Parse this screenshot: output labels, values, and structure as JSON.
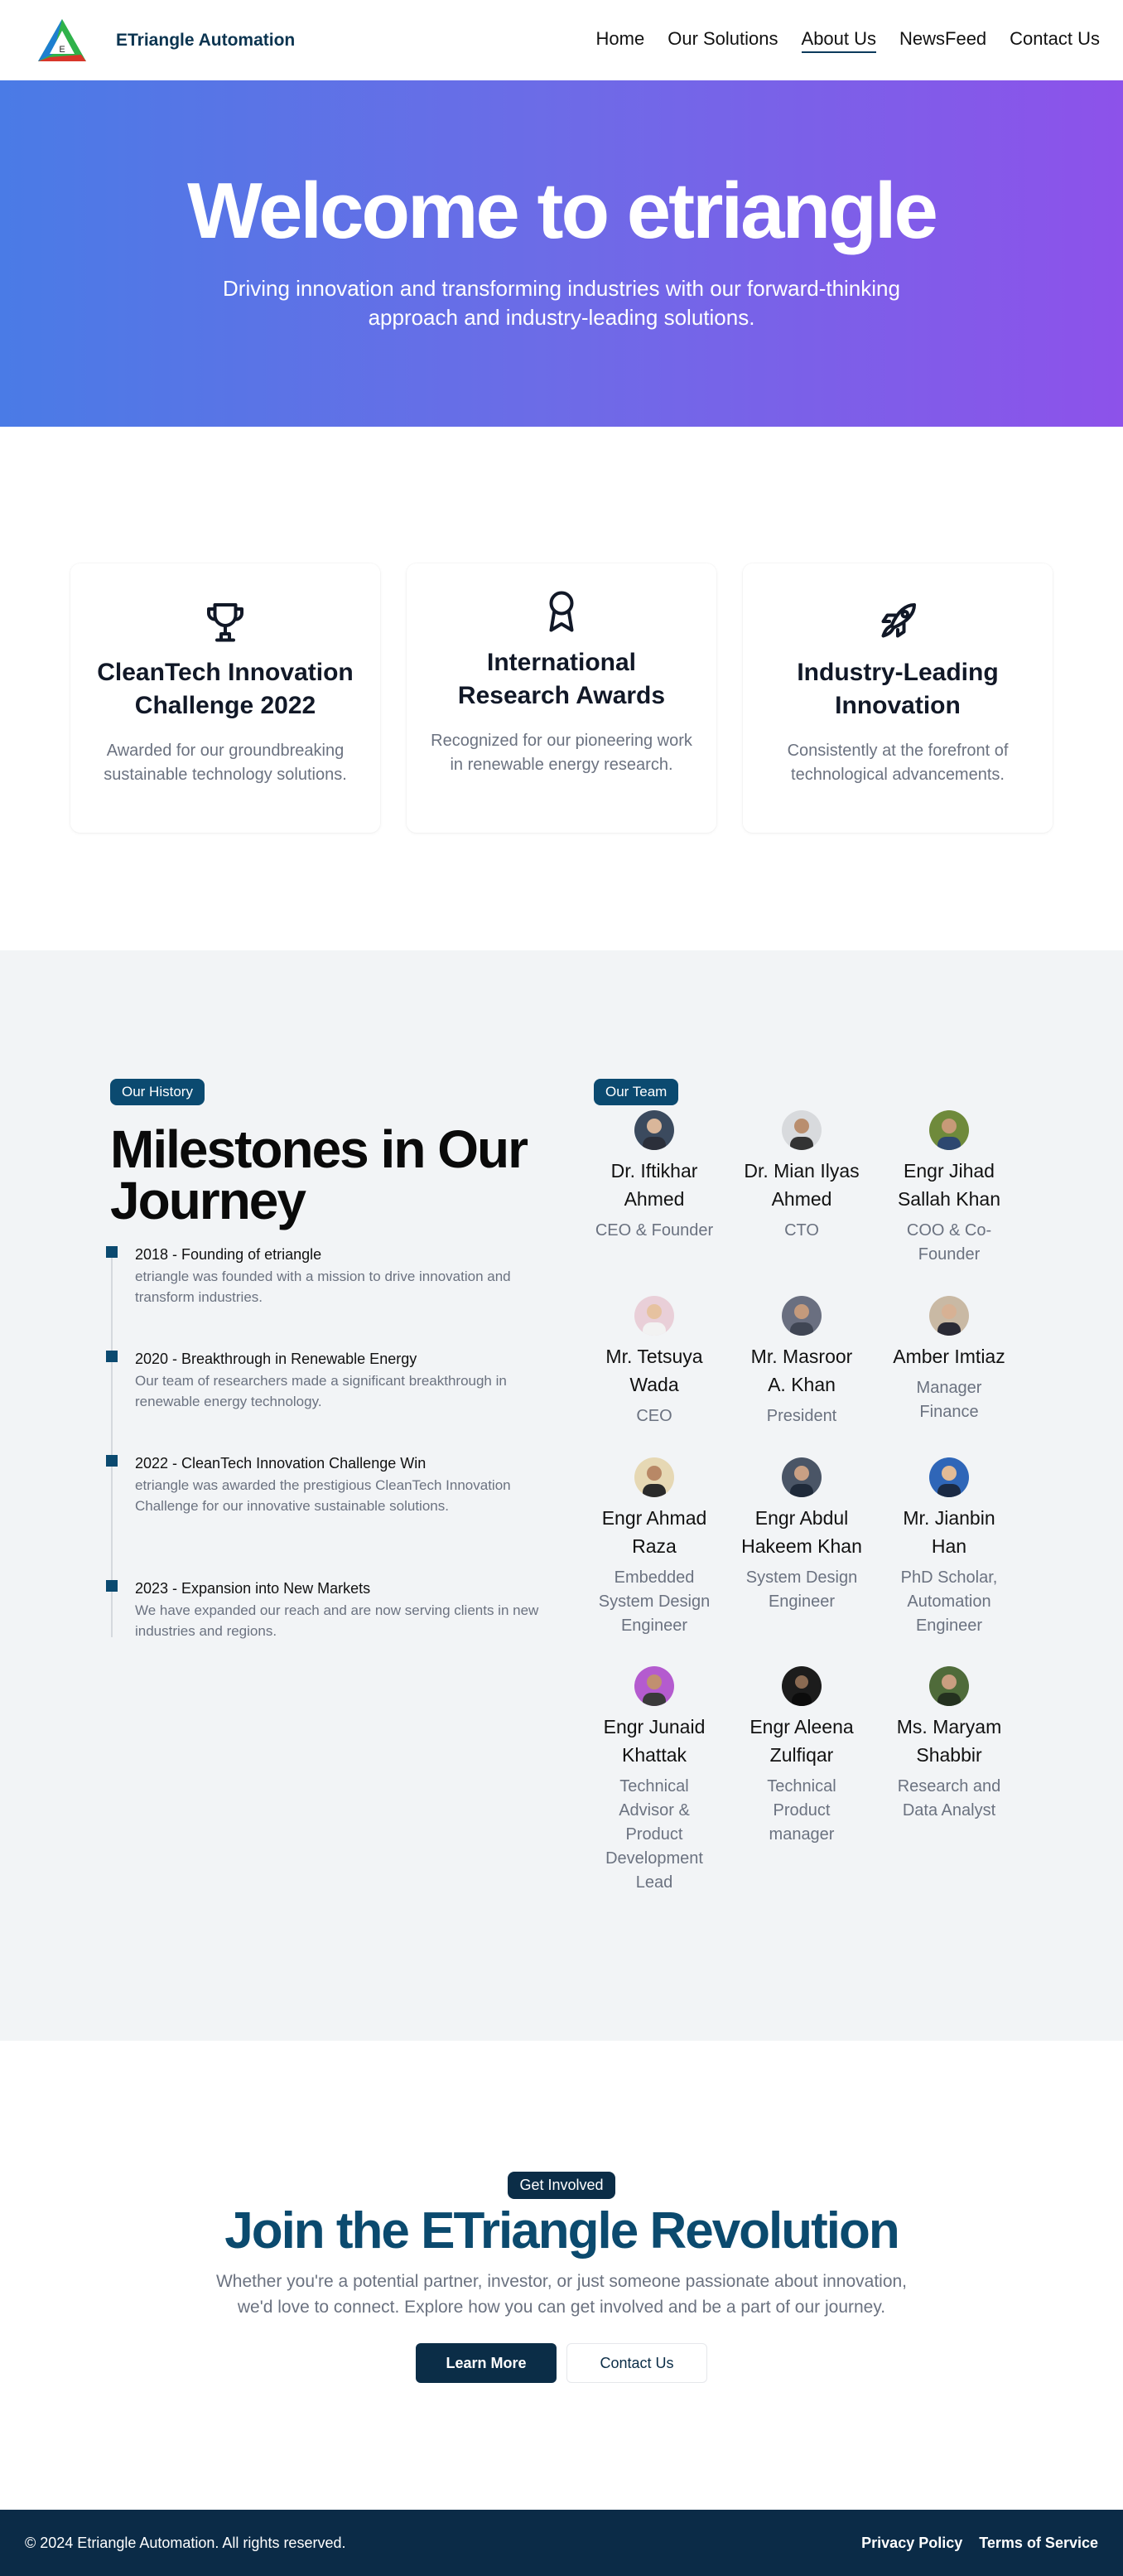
{
  "header": {
    "brand": "ETriangle Automation",
    "nav": [
      "Home",
      "Our Solutions",
      "About Us",
      "NewsFeed",
      "Contact Us"
    ]
  },
  "hero": {
    "title": "Welcome to etriangle",
    "subtitle": "Driving innovation and transforming industries with our forward-thinking approach and industry-leading solutions."
  },
  "awards": [
    {
      "icon": "trophy-icon",
      "title": "CleanTech Innovation Challenge 2022",
      "text": "Awarded for our groundbreaking sustainable technology solutions."
    },
    {
      "icon": "award-icon",
      "title": "International Research Awards",
      "text": "Recognized for our pioneering work in renewable energy research."
    },
    {
      "icon": "rocket-icon",
      "title": "Industry-Leading Innovation",
      "text": "Consistently at the forefront of technological advancements."
    }
  ],
  "history": {
    "tag": "Our History",
    "title": "Milestones in Our Journey",
    "items": [
      {
        "title": "2018 - Founding of etriangle",
        "text": "etriangle was founded with a mission to drive innovation and transform industries."
      },
      {
        "title": "2020 - Breakthrough in Renewable Energy",
        "text": "Our team of researchers made a significant breakthrough in renewable energy technology."
      },
      {
        "title": "2022 - CleanTech Innovation Challenge Win",
        "text": "etriangle was awarded the prestigious CleanTech Innovation Challenge for our innovative sustainable solutions."
      },
      {
        "title": "2023 - Expansion into New Markets",
        "text": "We have expanded our reach and are now serving clients in new industries and regions."
      }
    ]
  },
  "team": {
    "tag": "Our Team",
    "members": [
      {
        "name": "Dr. Iftikhar Ahmed",
        "role": "CEO & Founder",
        "color": "#3b4a5e"
      },
      {
        "name": "Dr. Mian Ilyas Ahmed",
        "role": "CTO",
        "color": "#d8dadd"
      },
      {
        "name": "Engr Jihad Sallah Khan",
        "role": "COO & Co-Founder",
        "color": "#6f8a3b"
      },
      {
        "name": "Mr. Tetsuya Wada",
        "role": "CEO",
        "color": "#e9cfd8"
      },
      {
        "name": "Mr. Masroor A. Khan",
        "role": "President",
        "color": "#6a6f80"
      },
      {
        "name": "Amber Imtiaz",
        "role": "Manager Finance",
        "color": "#c9b9a4"
      },
      {
        "name": "Engr Ahmad Raza",
        "role": "Embedded System Design Engineer",
        "color": "#e6d8b4"
      },
      {
        "name": "Engr Abdul Hakeem Khan",
        "role": "System Design Engineer",
        "color": "#4a5566"
      },
      {
        "name": "Mr. Jianbin Han",
        "role": "PhD Scholar, Automation Engineer",
        "color": "#2f66b8"
      },
      {
        "name": "Engr Junaid Khattak",
        "role": "Technical Advisor & Product Development Lead",
        "color": "#b45bcf"
      },
      {
        "name": "Engr Aleena Zulfiqar",
        "role": "Technical Product manager",
        "color": "#1c1c1c"
      },
      {
        "name": "Ms. Maryam Shabbir",
        "role": "Research and Data Analyst",
        "color": "#4f6b3a"
      }
    ]
  },
  "cta": {
    "tag": "Get Involved",
    "title": "Join the ETriangle Revolution",
    "text": "Whether you're a potential partner, investor, or just someone passionate about innovation, we'd love to connect. Explore how you can get involved and be a part of our journey.",
    "primary": "Learn More",
    "secondary": "Contact Us"
  },
  "footer": {
    "copyright": "© 2024 Etriangle Automation. All rights reserved.",
    "links": [
      "Privacy Policy",
      "Terms of Service"
    ]
  }
}
